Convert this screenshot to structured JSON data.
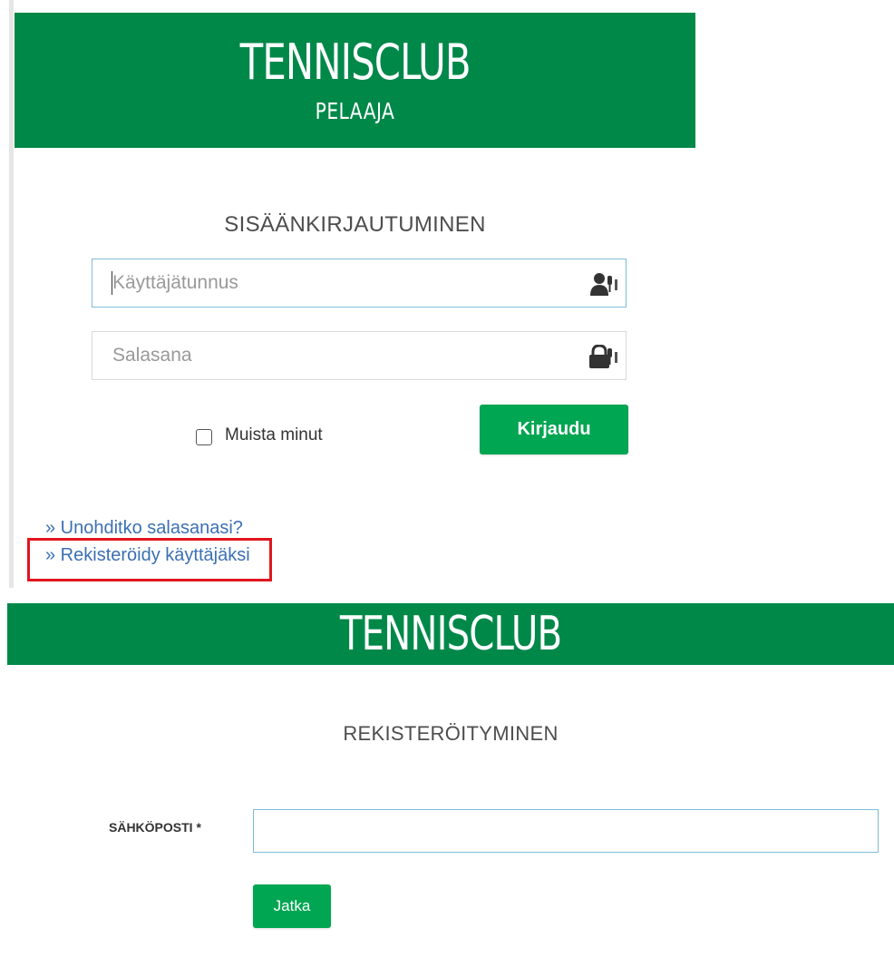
{
  "login": {
    "brand": "TENNISCLUB",
    "role": "PELAAJA",
    "heading": "SISÄÄNKIRJAUTUMINEN",
    "username_placeholder": "Käyttäjätunnus",
    "password_placeholder": "Salasana",
    "remember_label": "Muista minut",
    "login_button": "Kirjaudu",
    "forgot_link": "» Unohditko salasanasi?",
    "register_link": "» Rekisteröidy käyttäjäksi"
  },
  "register": {
    "brand": "TENNISCLUB",
    "heading": "REKISTERÖITYMINEN",
    "email_label": "SÄHKÖPOSTI *",
    "email_value": "",
    "continue_button": "Jatka"
  },
  "colors": {
    "banner": "#008849",
    "button": "#00a651",
    "link": "#3b70b3",
    "highlight": "#e0151f"
  },
  "icons": {
    "username": "user-key-icon",
    "password": "lock-key-icon"
  }
}
